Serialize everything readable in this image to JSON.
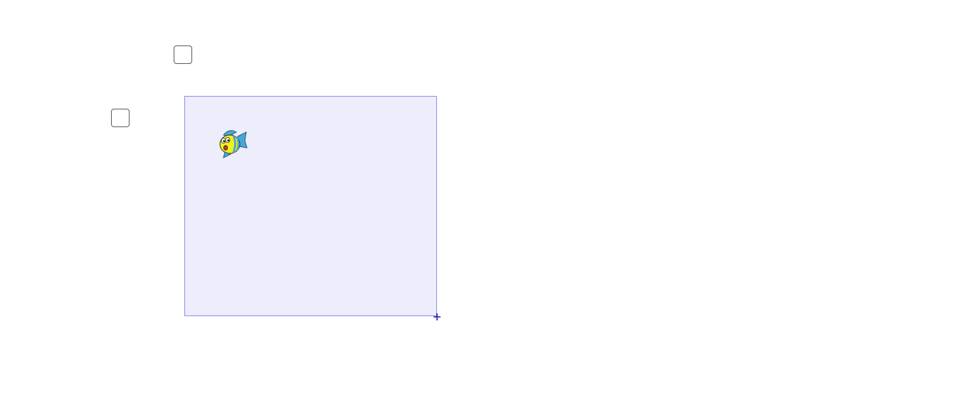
{
  "applet": {
    "background_color": "#ffffff"
  },
  "controls": {
    "checkbox_top": {
      "checked": false
    },
    "checkbox_left": {
      "checked": false
    }
  },
  "region": {
    "fill_color": "#eeedfb",
    "border_color": "#8c8cf2"
  },
  "corner_point": {
    "color": "#1a1aa8"
  },
  "sprite": {
    "icon": "fish-icon",
    "body_color": "#f2ef1a",
    "stripe_color": "#4aa7d6"
  }
}
